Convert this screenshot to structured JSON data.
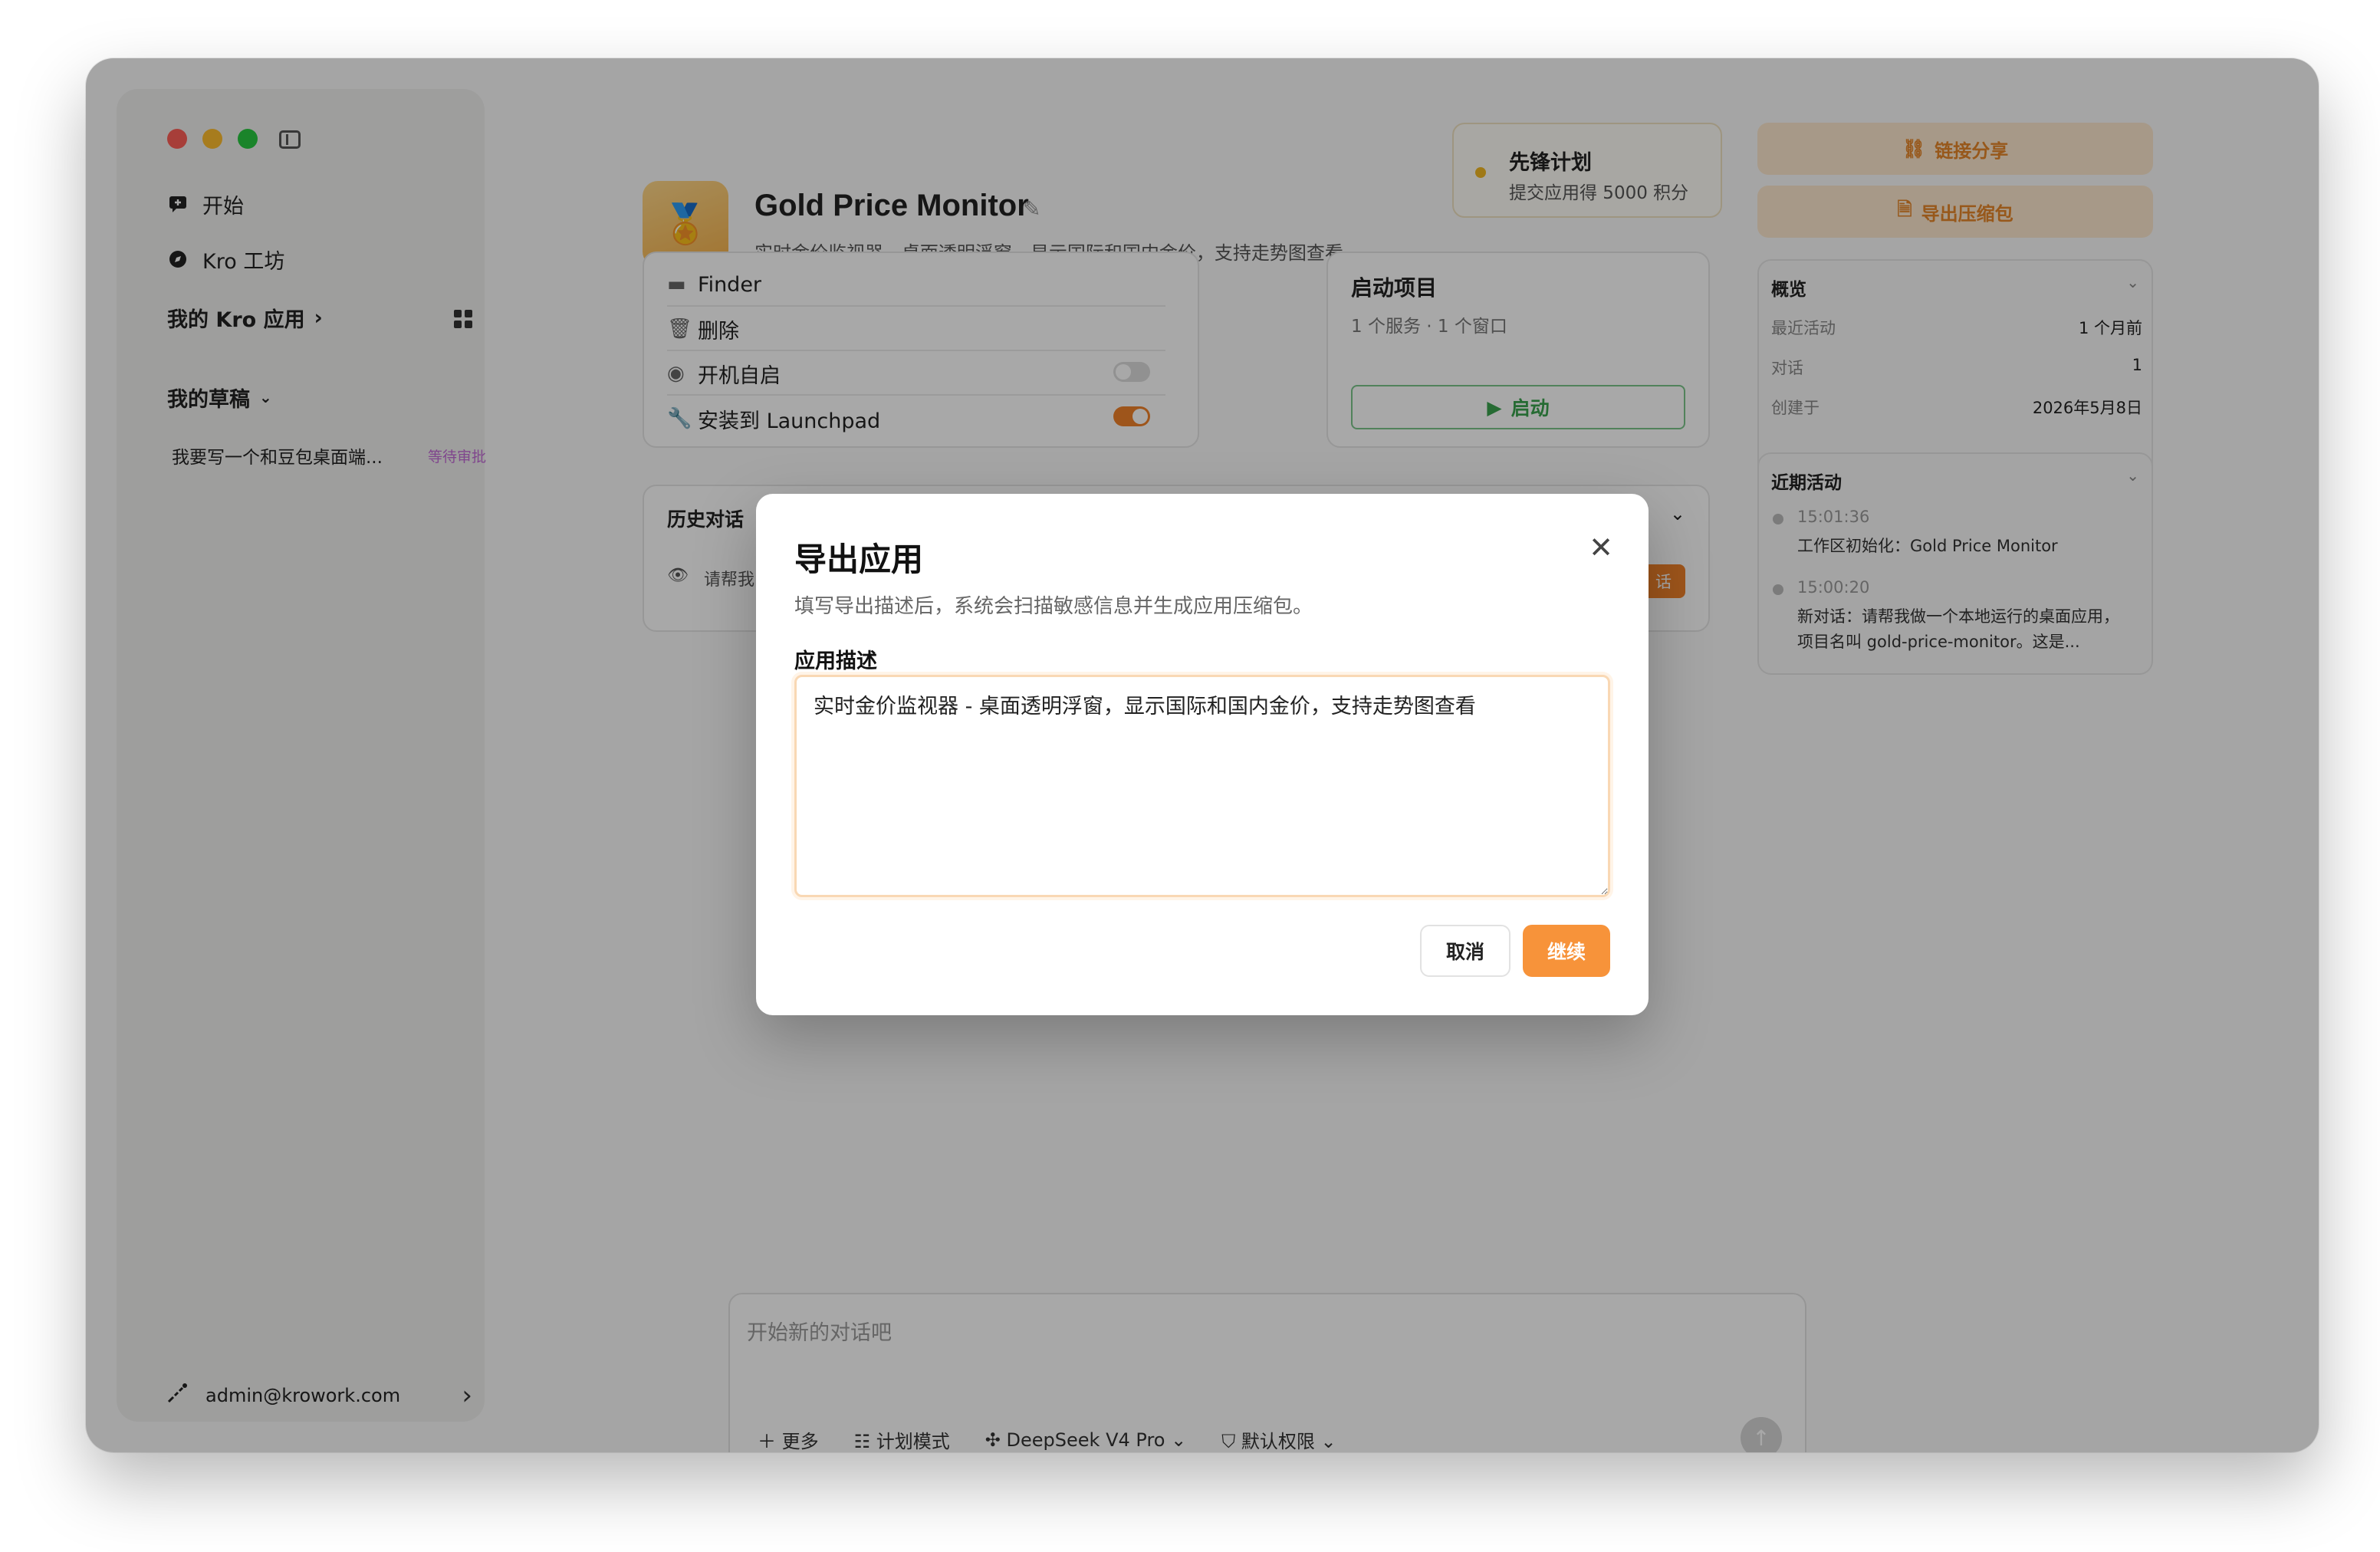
{
  "sidebar": {
    "start_label": "开始",
    "workshop_label": "Kro 工坊",
    "my_apps_label": "我的 Kro 应用",
    "drafts_label": "我的草稿",
    "draft_item": {
      "title": "我要写一个和豆包桌面端...",
      "status": "等待审批"
    },
    "user_email": "admin@krowork.com"
  },
  "app": {
    "title": "Gold Price Monitor",
    "subtitle": "实时金价监视器 - 桌面透明浮窗，显示国际和国内金价，支持走势图查看",
    "icon": "medal-icon"
  },
  "plan": {
    "title": "先锋计划",
    "subtitle": "提交应用得 5000 积分"
  },
  "actions": {
    "share_label": "链接分享",
    "export_label": "导出压缩包"
  },
  "file_actions": {
    "finder": "Finder",
    "delete": "删除",
    "autostart": "开机自启",
    "launchpad": "安装到 Launchpad",
    "autostart_on": false,
    "launchpad_on": true
  },
  "startup": {
    "title": "启动项目",
    "subtitle": "1 个服务 · 1 个窗口",
    "launch_label": "启动"
  },
  "history": {
    "title": "历史对话",
    "first_item": "请帮我",
    "badge": "话"
  },
  "overview": {
    "title": "概览",
    "rows": [
      {
        "key": "最近活动",
        "value": "1 个月前"
      },
      {
        "key": "对话",
        "value": "1"
      },
      {
        "key": "创建于",
        "value": "2026年5月8日"
      }
    ]
  },
  "recent": {
    "title": "近期活动",
    "items": [
      {
        "time": "15:01:36",
        "text": "工作区初始化：Gold Price Monitor"
      },
      {
        "time": "15:00:20",
        "text": "新对话：请帮我做一个本地运行的桌面应用，项目名叫 gold-price-monitor。这是..."
      }
    ]
  },
  "chat": {
    "placeholder": "开始新的对话吧",
    "more": "更多",
    "plan_mode": "计划模式",
    "model": "DeepSeek V4 Pro",
    "permission": "默认权限"
  },
  "modal": {
    "title": "导出应用",
    "description": "填写导出描述后，系统会扫描敏感信息并生成应用压缩包。",
    "field_label": "应用描述",
    "field_value": "实时金价监视器 - 桌面透明浮窗，显示国际和国内金价，支持走势图查看",
    "cancel_label": "取消",
    "continue_label": "继续"
  },
  "colors": {
    "accent": "#f7933a",
    "launch_green": "#3aa34e"
  }
}
